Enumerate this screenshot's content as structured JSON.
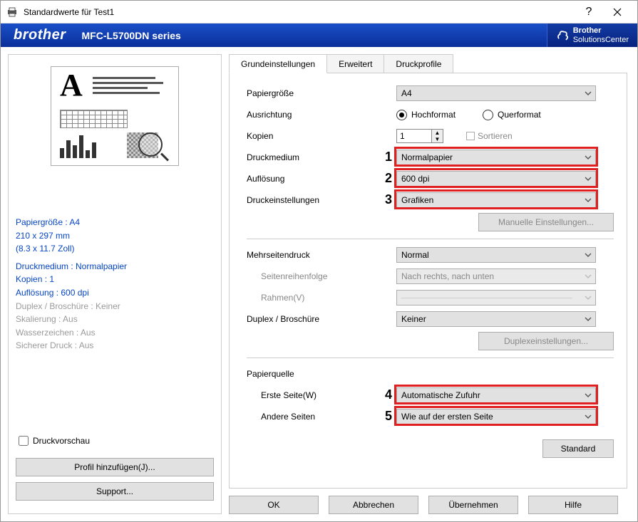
{
  "window": {
    "title": "Standardwerte für Test1"
  },
  "brand": {
    "logo": "brother",
    "model": "MFC-L5700DN series",
    "solutions_line1": "Brother",
    "solutions_line2": "SolutionsCenter"
  },
  "tabs": {
    "basic": "Grundeinstellungen",
    "advanced": "Erweitert",
    "profiles": "Druckprofile"
  },
  "labels": {
    "paper_size": "Papiergröße",
    "orientation": "Ausrichtung",
    "copies": "Kopien",
    "media": "Druckmedium",
    "resolution": "Auflösung",
    "print_settings": "Druckeinstellungen",
    "manual_settings": "Manuelle Einstellungen...",
    "multipage": "Mehrseitendruck",
    "page_order": "Seitenreihenfolge",
    "border": "Rahmen(V)",
    "duplex": "Duplex / Broschüre",
    "duplex_settings": "Duplexeinstellungen...",
    "paper_source": "Papierquelle",
    "first_page": "Erste Seite(W)",
    "other_pages": "Andere Seiten",
    "standard": "Standard",
    "portrait": "Hochformat",
    "landscape": "Querformat",
    "collate": "Sortieren"
  },
  "values": {
    "paper_size": "A4",
    "copies": "1",
    "media": "Normalpapier",
    "resolution": "600 dpi",
    "print_settings": "Grafiken",
    "multipage": "Normal",
    "page_order": "Nach rechts, nach unten",
    "duplex": "Keiner",
    "first_page": "Automatische Zufuhr",
    "other_pages": "Wie auf der ersten Seite"
  },
  "annotations": {
    "n1": "1",
    "n2": "2",
    "n3": "3",
    "n4": "4",
    "n5": "5"
  },
  "summary": {
    "s1": "Papiergröße : A4",
    "s2": "210 x 297 mm",
    "s3": "(8.3 x 11.7 Zoll)",
    "s4": "Druckmedium : Normalpapier",
    "s5": "Kopien : 1",
    "s6": "Auflösung : 600 dpi",
    "s7": "Duplex / Broschüre : Keiner",
    "s8": "Skalierung : Aus",
    "s9": "Wasserzeichen : Aus",
    "s10": "Sicherer Druck : Aus"
  },
  "left": {
    "preview_chk": "Druckvorschau",
    "add_profile": "Profil hinzufügen(J)...",
    "support": "Support..."
  },
  "bottom": {
    "ok": "OK",
    "cancel": "Abbrechen",
    "apply": "Übernehmen",
    "help": "Hilfe"
  }
}
